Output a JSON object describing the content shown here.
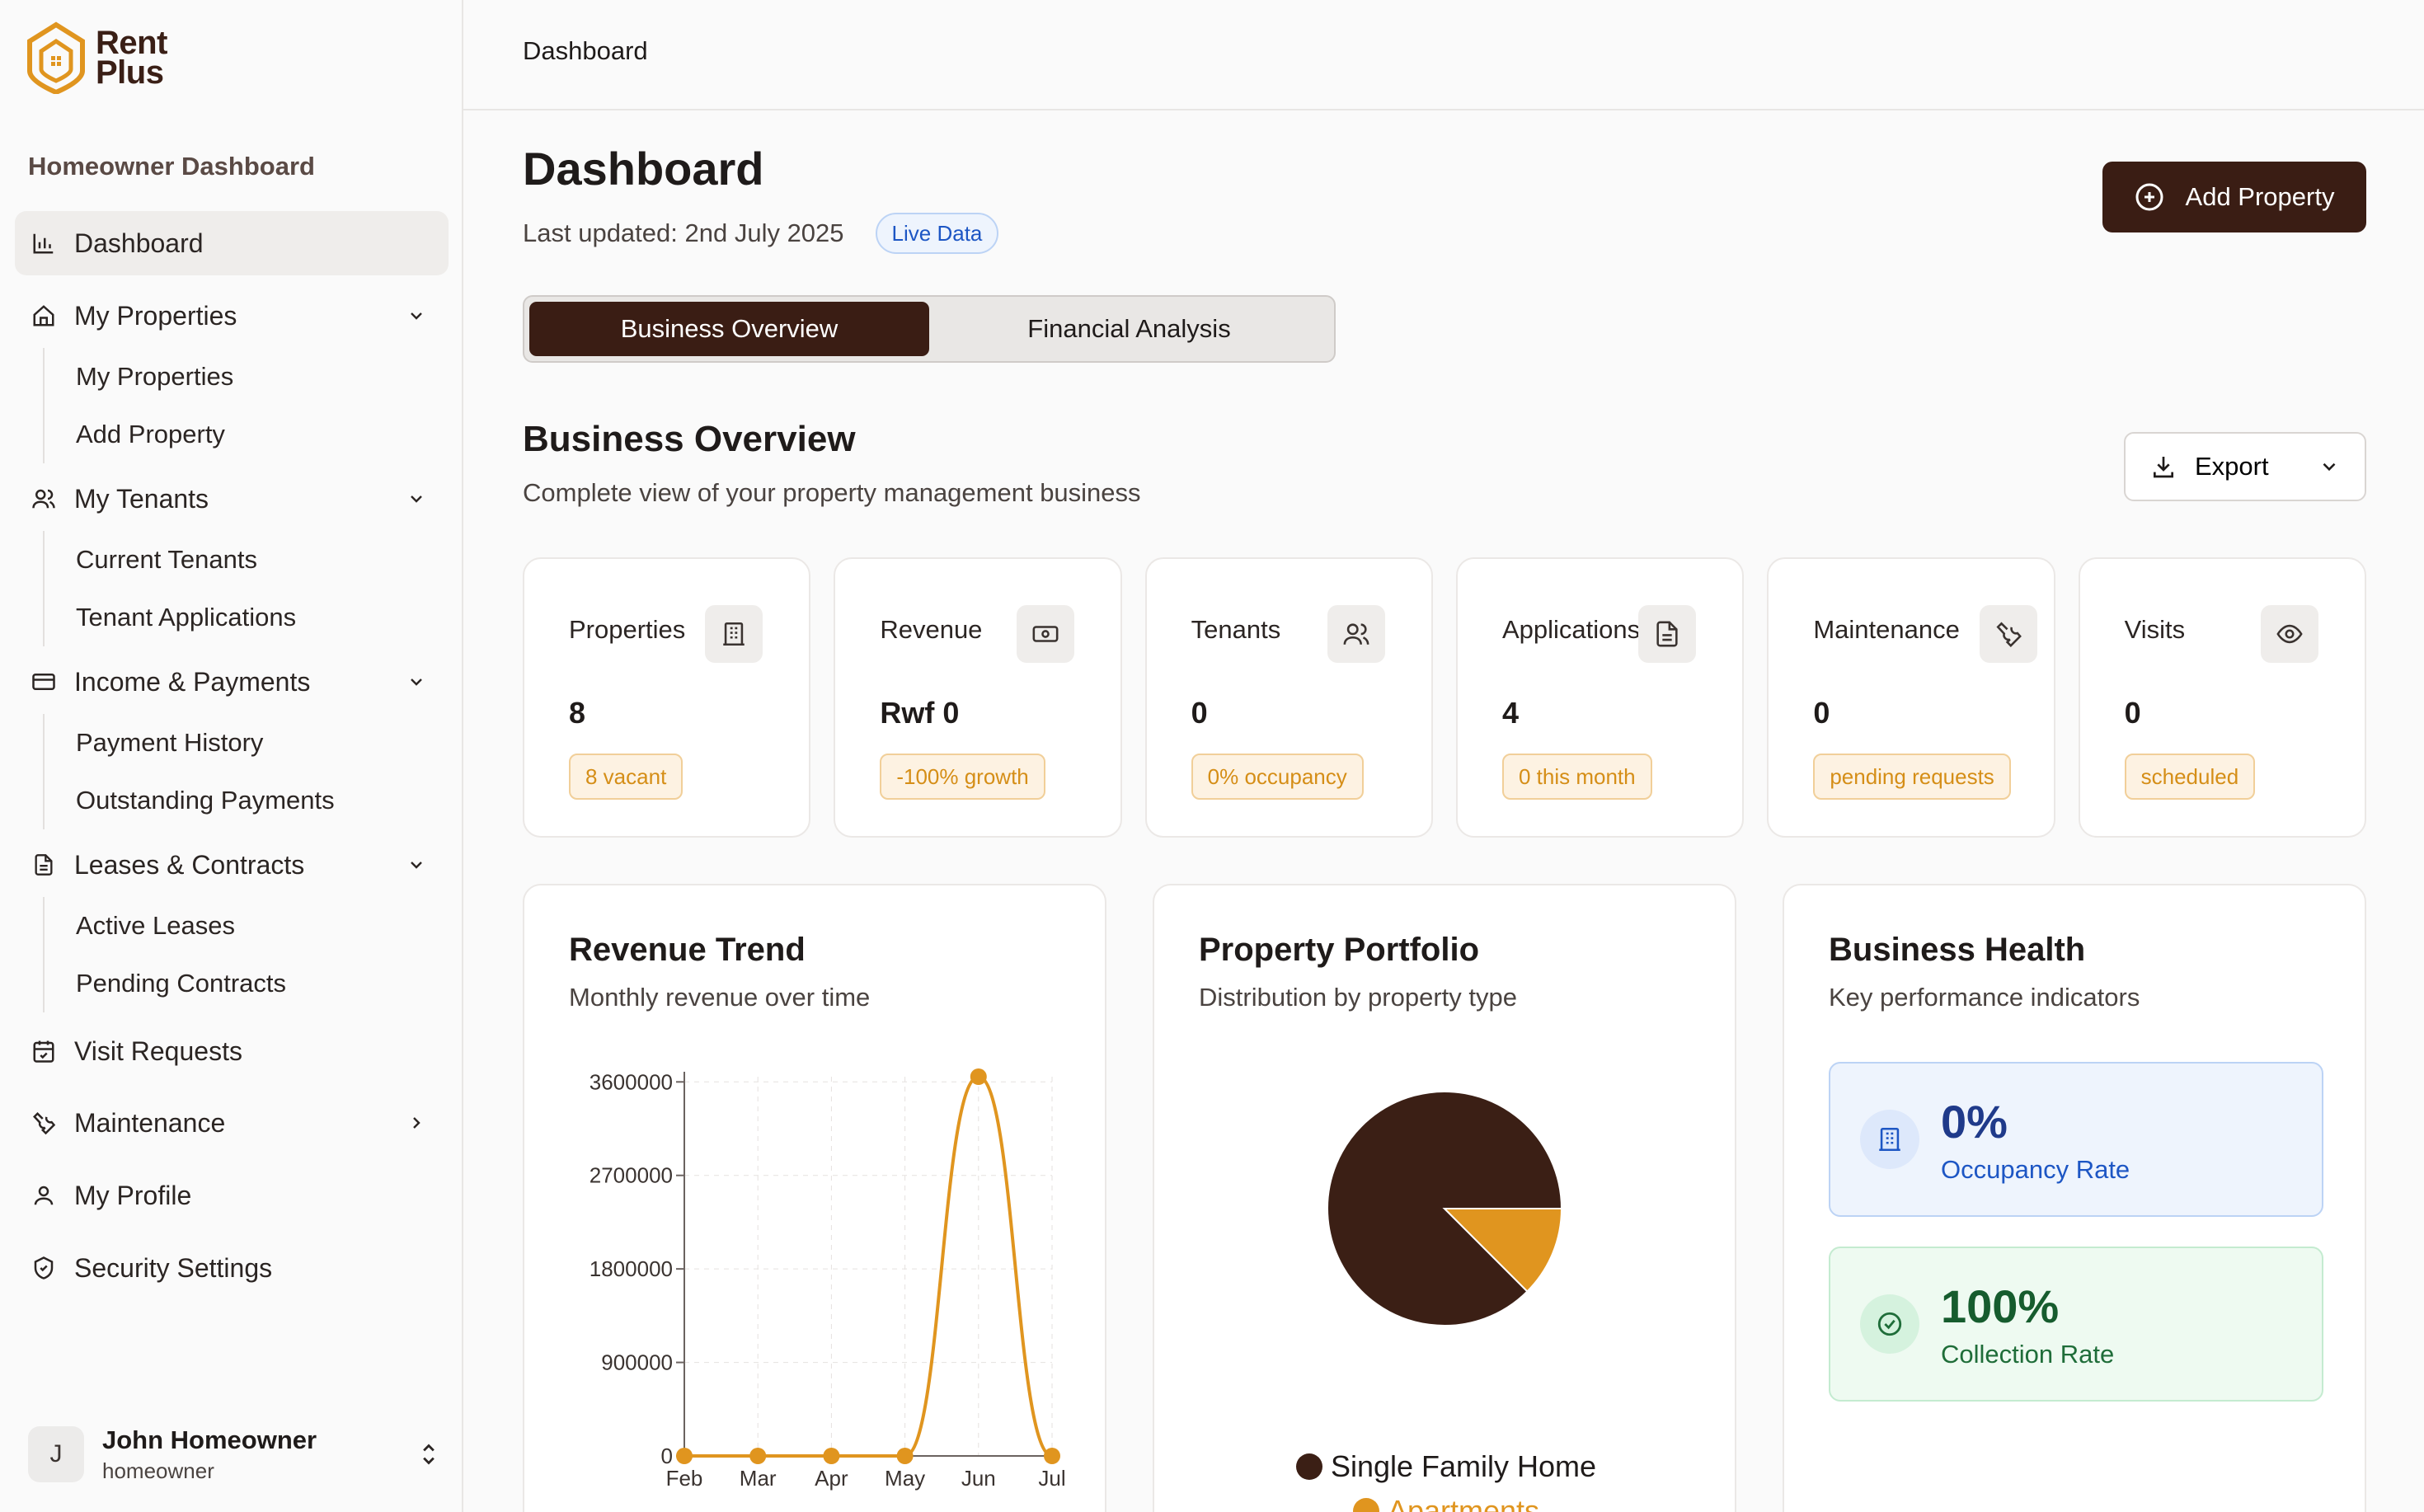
{
  "brand": {
    "line1": "Rent",
    "line2": "Plus"
  },
  "sidebar": {
    "heading": "Homeowner Dashboard",
    "dashboard": "Dashboard",
    "groups": [
      {
        "label": "My Properties",
        "items": [
          "My Properties",
          "Add Property"
        ]
      },
      {
        "label": "My Tenants",
        "items": [
          "Current Tenants",
          "Tenant Applications"
        ]
      },
      {
        "label": "Income & Payments",
        "items": [
          "Payment History",
          "Outstanding Payments"
        ]
      },
      {
        "label": "Leases & Contracts",
        "items": [
          "Active Leases",
          "Pending Contracts"
        ]
      }
    ],
    "visit_requests": "Visit Requests",
    "maintenance": "Maintenance",
    "my_profile": "My Profile",
    "security_settings": "Security Settings",
    "user": {
      "initial": "J",
      "name": "John Homeowner",
      "role": "homeowner"
    }
  },
  "topbar": {
    "breadcrumb": "Dashboard"
  },
  "header": {
    "title": "Dashboard",
    "last_updated": "Last updated: 2nd July 2025",
    "live_badge": "Live Data",
    "add_property": "Add Property"
  },
  "tabs": [
    "Business Overview",
    "Financial Analysis"
  ],
  "overview": {
    "title": "Business Overview",
    "subtitle": "Complete view of your property management business",
    "export": "Export"
  },
  "stats": [
    {
      "label": "Properties",
      "value": "8",
      "badge": "8 vacant",
      "icon": "building-icon"
    },
    {
      "label": "Revenue",
      "value": "Rwf 0",
      "badge": "-100% growth",
      "icon": "banknote-icon"
    },
    {
      "label": "Tenants",
      "value": "0",
      "badge": "0% occupancy",
      "icon": "users-icon"
    },
    {
      "label": "Applications",
      "value": "4",
      "badge": "0 this month",
      "icon": "document-icon"
    },
    {
      "label": "Maintenance",
      "value": "0",
      "badge": "pending requests",
      "icon": "wrench-icon"
    },
    {
      "label": "Visits",
      "value": "0",
      "badge": "scheduled",
      "icon": "eye-icon"
    }
  ],
  "revenue_panel": {
    "title": "Revenue Trend",
    "subtitle": "Monthly revenue over time"
  },
  "portfolio_panel": {
    "title": "Property Portfolio",
    "subtitle": "Distribution by property type"
  },
  "health_panel": {
    "title": "Business Health",
    "subtitle": "Key performance indicators",
    "occupancy_value": "0%",
    "occupancy_label": "Occupancy Rate",
    "collection_value": "100%",
    "collection_label": "Collection Rate"
  },
  "colors": {
    "brand": "#3a1d14",
    "accent": "#e0951f",
    "brand_orange": "#e0951f"
  },
  "chart_data": [
    {
      "type": "line",
      "x": [
        "Feb",
        "Mar",
        "Apr",
        "May",
        "Jun",
        "Jul"
      ],
      "series": [
        {
          "values": [
            0,
            0,
            0,
            0,
            3650000,
            0
          ]
        }
      ],
      "yticks": [
        0,
        900000,
        1800000,
        2700000,
        3600000
      ],
      "ylim": [
        0,
        3650000
      ],
      "grid": true,
      "color": "#e0951f"
    },
    {
      "type": "pie",
      "labels": [
        "Single Family Home",
        "Apartments"
      ],
      "values": [
        7,
        1
      ],
      "colors": [
        "#3b1f15",
        "#e0951f"
      ],
      "legend": "bottom"
    }
  ]
}
